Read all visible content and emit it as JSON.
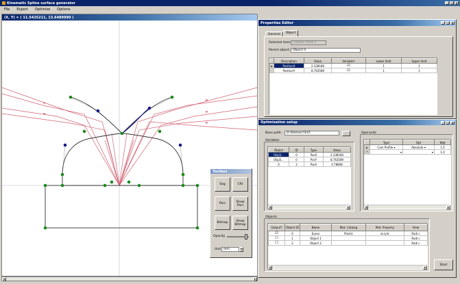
{
  "app": {
    "title": "Kinematic Spline surface generator",
    "menu": [
      "File",
      "Export",
      "Optimize",
      "Options"
    ]
  },
  "canvas": {
    "coord_readout": "(X, Y) = ( 11.5425211, 13.6489990 )"
  },
  "properties": {
    "title": "Properties Editor",
    "tabs": [
      "General",
      "Object"
    ],
    "active_tab": "Object",
    "selected_item_label": "Selected item:",
    "selected_item_value": "Camber Point 1",
    "parent_label": "Parent object:",
    "parent_value": "Object 0",
    "headers": [
      "Description",
      "Value",
      "Variable?",
      "Lower limit",
      "Upper limit"
    ],
    "rows": [
      {
        "desc": "PositionX",
        "value": "2.338180",
        "variable": "☑",
        "lower": "1",
        "upper": "1"
      },
      {
        "desc": "PositionY",
        "value": "8.763589",
        "variable": "☑",
        "lower": "1",
        "upper": "1"
      }
    ]
  },
  "optimizer": {
    "title": "Optimization setup",
    "base_path_label": "Base path:",
    "base_path_value": "D:\\Demos\\TEST",
    "browse": "...",
    "variables_label": "Variables",
    "var_headers": [
      "Object",
      "ID",
      "Type",
      "Value"
    ],
    "var_rows": [
      {
        "object": "Obj.B...",
        "id": "0",
        "type": "PosX",
        "value": "2.338180"
      },
      {
        "object": "Obj.B...",
        "id": "0",
        "type": "PosY",
        "value": "8.763589"
      },
      {
        "object": "0",
        "id": "2",
        "type": "PosX",
        "value": "4.78808"
      }
    ],
    "operands_label": "Operands",
    "op_headers": [
      "Type",
      "Opt",
      "Wgt"
    ],
    "op_rows": [
      {
        "marker": "►",
        "type": "Cam Profile",
        "opt": "Absolute",
        "wgt": "1.0"
      },
      {
        "marker": "*",
        "type": "",
        "opt": "",
        "wgt": "1.0"
      }
    ],
    "objects_label": "Objects",
    "obj_headers": [
      "Output?",
      "Object ID",
      "Name",
      "Mat. Catalog",
      "Mat. Property",
      "View"
    ],
    "obj_rows": [
      {
        "output": "☑",
        "id": "0",
        "name": "Eyess",
        "catalog": "Plastic",
        "property": "acrylic",
        "view": "Radi c"
      },
      {
        "output": "☐",
        "id": "1",
        "name": "Object 1",
        "catalog": "",
        "property": "",
        "view": "Radi c"
      },
      {
        "output": "☐",
        "id": "2",
        "name": "Object 2",
        "catalog": "",
        "property": "",
        "view": "Radi c"
      }
    ],
    "start_button": "Start"
  },
  "toolbox": {
    "title": "Toolbox",
    "buttons": [
      "Seg",
      "Cfit",
      "Pars",
      "Show Pars",
      "Bitmap",
      "Show Bitmap"
    ],
    "opacity_label": "Opacity",
    "unit_label": "Unit",
    "unit_value": "mm"
  },
  "colors": {
    "title_active": "#0a246a",
    "rays": "#d06070",
    "curve": "#303030",
    "point_green": "#1a8a1a",
    "point_blue": "#1a1a8a",
    "selection": "#0a246a"
  }
}
